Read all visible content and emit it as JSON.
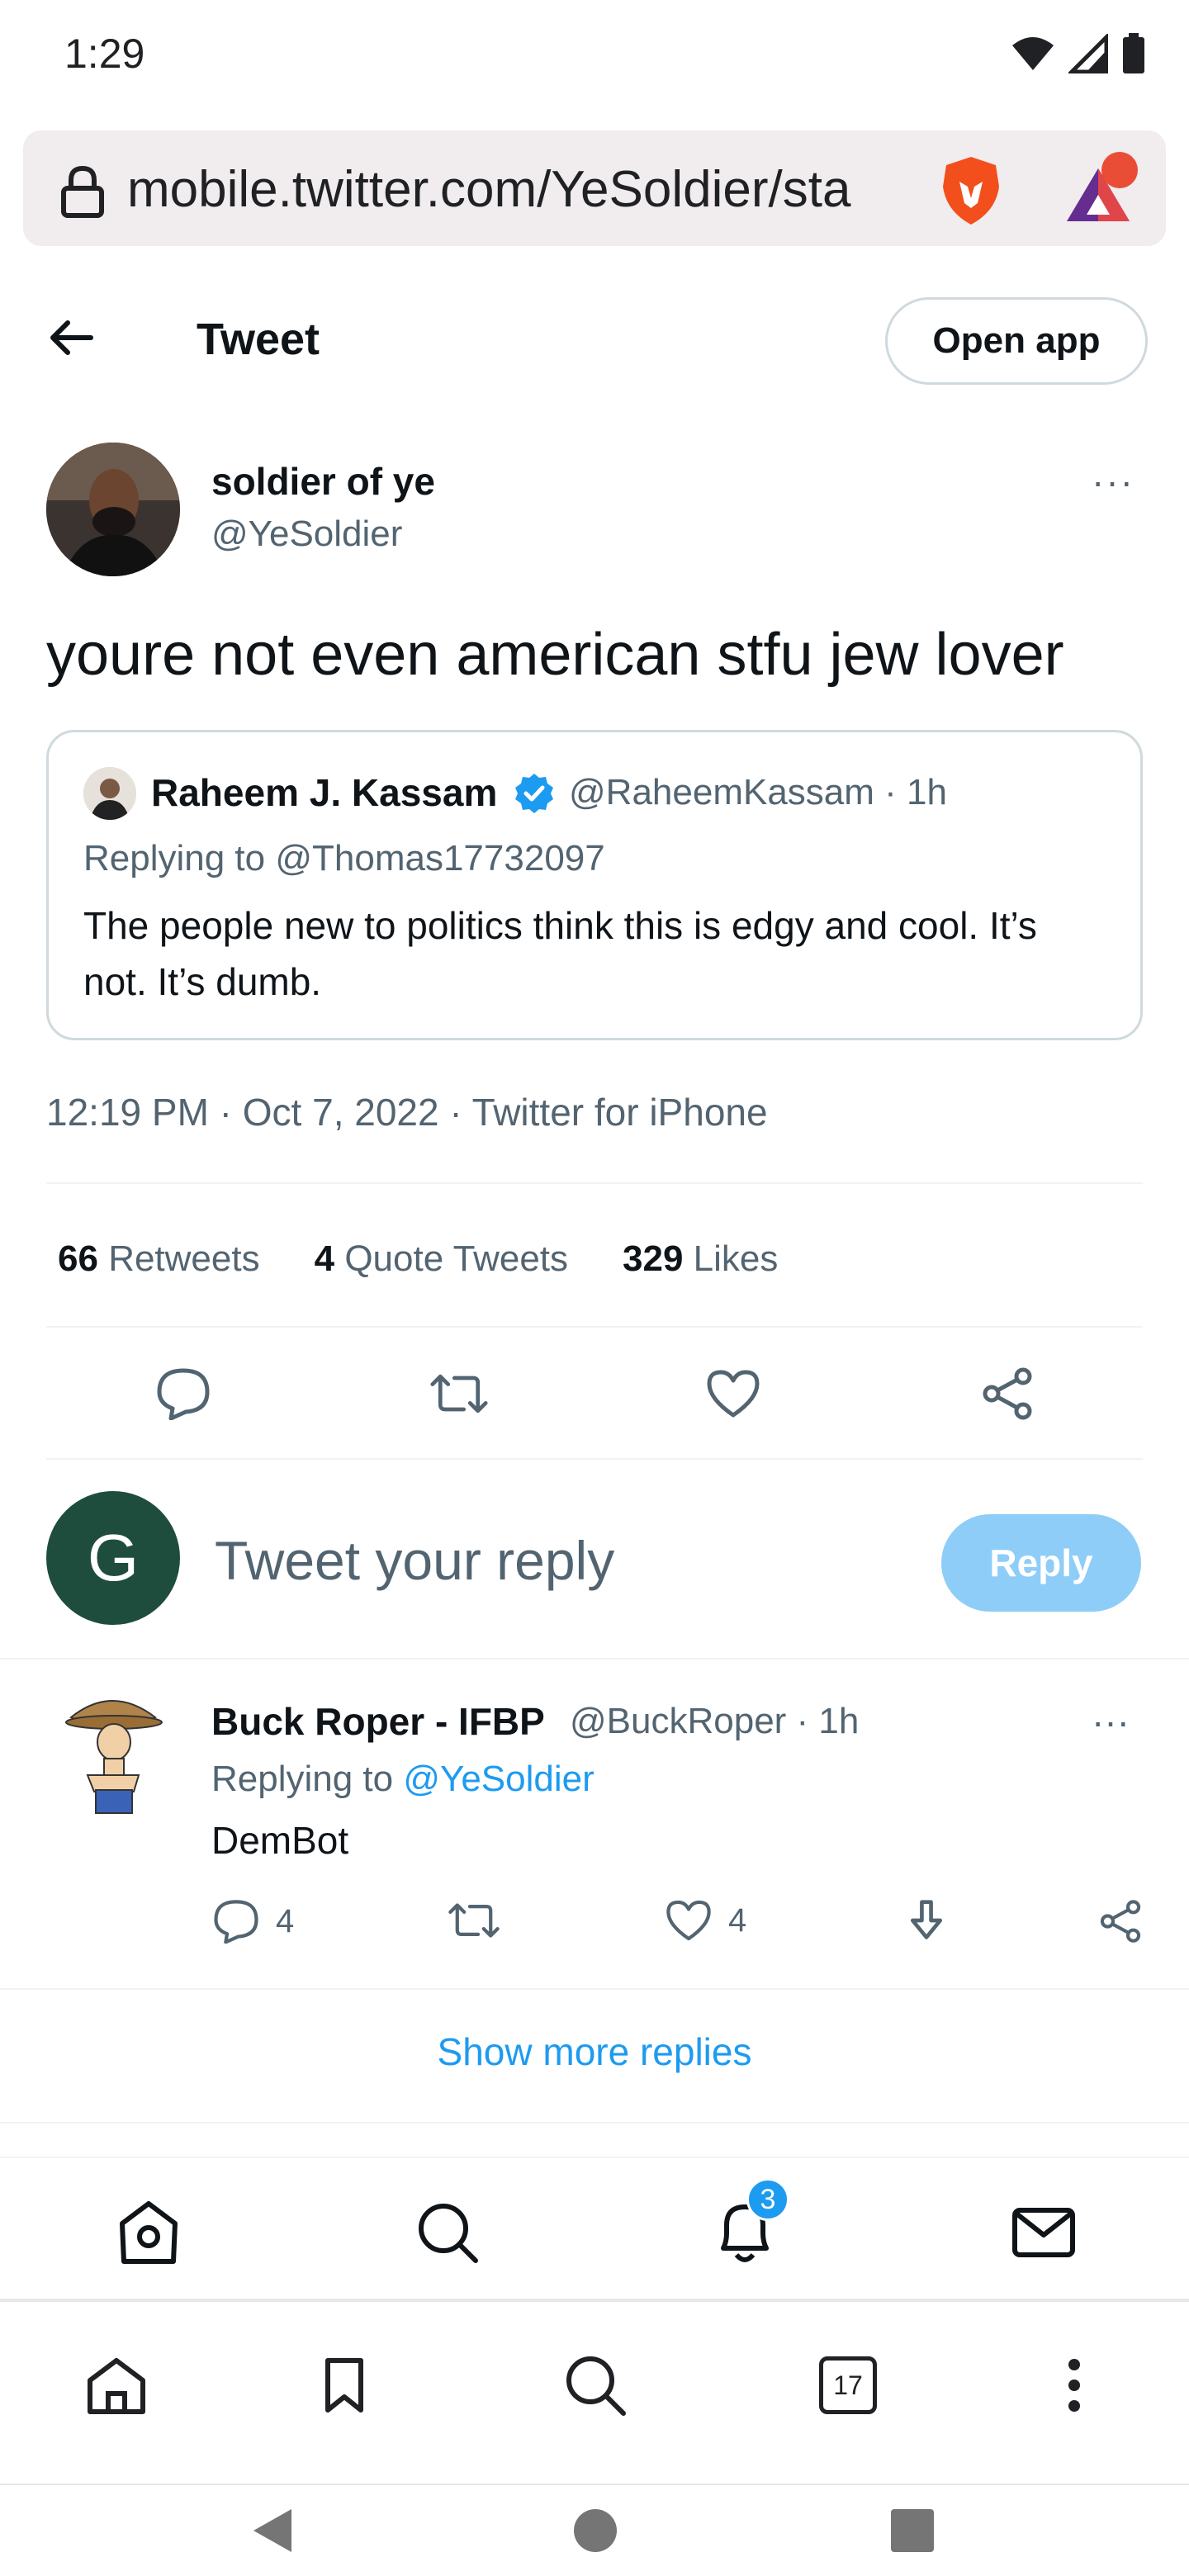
{
  "status_bar": {
    "time": "1:29"
  },
  "browser": {
    "url": "mobile.twitter.com/YeSoldier/sta",
    "tabs_count": "17"
  },
  "header": {
    "title": "Tweet",
    "open_app_label": "Open app"
  },
  "tweet": {
    "author_name": "soldier of ye",
    "author_handle": "@YeSoldier",
    "more_label": "···",
    "text": "youre not even american stfu jew lover",
    "quoted": {
      "name": "Raheem J. Kassam",
      "handle_time": "@RaheemKassam · 1h",
      "replying_to": "Replying to @Thomas17732097",
      "text": "The people new to politics think this is edgy and cool. It’s not. It’s dumb."
    },
    "meta": "12:19 PM · Oct 7, 2022 · Twitter for iPhone",
    "stats": {
      "retweets_count": "66",
      "retweets_label": "Retweets",
      "quotes_count": "4",
      "quotes_label": "Quote Tweets",
      "likes_count": "329",
      "likes_label": "Likes"
    }
  },
  "composer": {
    "avatar_letter": "G",
    "placeholder": "Tweet your reply",
    "reply_label": "Reply"
  },
  "reply": {
    "name": "Buck Roper - IFBP",
    "handle_time": "@BuckRoper · 1h",
    "replying_prefix": "Replying to ",
    "replying_handle": "@YeSoldier",
    "text": "DemBot",
    "reply_count": "4",
    "like_count": "4",
    "more_label": "···"
  },
  "show_more_label": "Show more replies",
  "nav": {
    "notifications_badge": "3"
  },
  "colors": {
    "accent": "#1d9bf0",
    "reply_button_disabled": "#8ecdf7",
    "avatar_me": "#1e4d3e"
  }
}
